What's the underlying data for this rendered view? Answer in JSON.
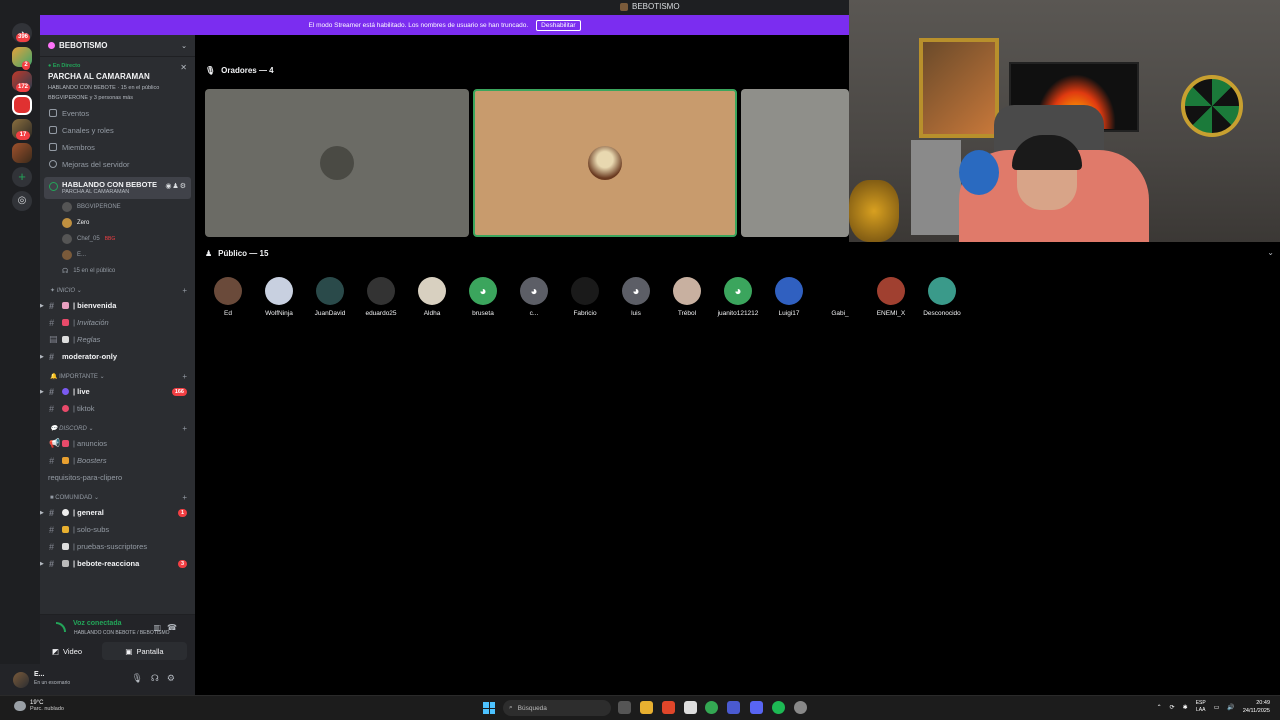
{
  "window": {
    "title": "BEBOTISMO"
  },
  "banner": {
    "text": "El modo Streamer está habilitado. Los nombres de usuario se han truncado.",
    "button": "Deshabilitar"
  },
  "rail": {
    "badges": [
      "396",
      "2",
      "172",
      "17"
    ]
  },
  "server": {
    "name": "BEBOTISMO",
    "event": {
      "status": "En Directo",
      "title": "PARCHA AL CAMARAMAN",
      "info": "HABLANDO CON BEBOTE · 15 en el público",
      "people": "BBGVIPERONE y 3 personas más"
    },
    "menu": [
      "Eventos",
      "Canales y roles",
      "Miembros",
      "Mejoras del servidor"
    ],
    "stage": {
      "name": "HABLANDO CON BEBOTE",
      "sub": "PARCHA AL CAMARAMAN",
      "users": [
        "BBGVIPERONE",
        "Zero",
        "Chef_05",
        "E..."
      ],
      "user3_tag": "BBG",
      "audience": "15 en el público"
    },
    "categories": [
      {
        "name": "INICIO",
        "channels": [
          {
            "name": "| bienvenida",
            "unread": true
          },
          {
            "name": "| Invitación",
            "italic": true
          },
          {
            "name": "| Reglas",
            "italic": true
          },
          {
            "name": "moderator-only",
            "unread": true
          }
        ]
      },
      {
        "name": "IMPORTANTE",
        "channels": [
          {
            "name": "| live",
            "unread": true,
            "badge": "166"
          },
          {
            "name": "| tiktok"
          }
        ]
      },
      {
        "name": "DISCORD",
        "channels": [
          {
            "name": "| anuncios"
          },
          {
            "name": "| Boosters",
            "italic": true
          },
          {
            "name": "requisitos-para-clipero"
          }
        ]
      },
      {
        "name": "COMUNIDAD",
        "channels": [
          {
            "name": "| general",
            "unread": true,
            "badge": "1"
          },
          {
            "name": "| solo-subs"
          },
          {
            "name": "| pruebas-suscriptores"
          },
          {
            "name": "| bebote-reacciona",
            "unread": true,
            "badge": "3"
          }
        ]
      }
    ]
  },
  "voice": {
    "status": "Voz conectada",
    "sub": "HABLANDO CON BEBOTE / BEBOTISMO",
    "video": "Video",
    "screen": "Pantalla"
  },
  "user": {
    "name": "E...",
    "status": "En un escenario"
  },
  "main": {
    "speakers_header": "Oradores — 4",
    "audience_header": "Público — 15",
    "audience": [
      "Ed",
      "WolfNinja",
      "JuanDavid",
      "eduardo25",
      "Aldha",
      "bruseta",
      "c...",
      "Fabricio",
      "luis",
      "Trébol",
      "juanito121212",
      "Luigi17",
      "Gabi_",
      "ENEMI_X",
      "Desconocido"
    ]
  },
  "taskbar": {
    "weather_temp": "19°C",
    "weather_desc": "Parc. nublado",
    "search": "Búsqueda",
    "lang1": "ESP",
    "lang2": "LAA",
    "time": "20:49",
    "date": "24/11/2025"
  },
  "colors": {
    "accent": "#5865f2",
    "streamer_banner": "#7b2df0",
    "online": "#23a559",
    "badge": "#f23f43"
  }
}
